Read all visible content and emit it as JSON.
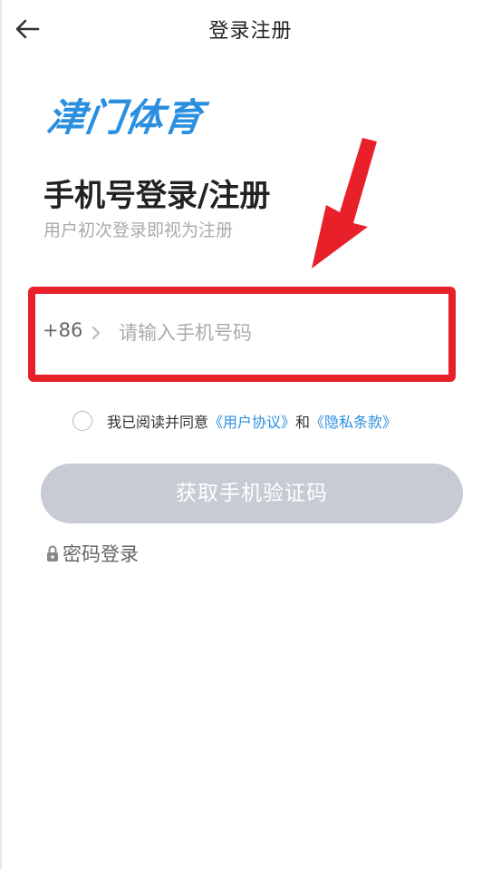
{
  "header": {
    "title": "登录注册",
    "back_icon": "back-arrow-icon"
  },
  "brand": {
    "name": "津门体育",
    "color": "#2b8fe0"
  },
  "login": {
    "heading": "手机号登录/注册",
    "subheading": "用户初次登录即视为注册"
  },
  "phone": {
    "country_code": "+86",
    "placeholder": "请输入手机号码",
    "value": ""
  },
  "agreement": {
    "checked": false,
    "prefix": "我已阅读并同意",
    "user_agreement": "《用户协议》",
    "and": "和",
    "privacy_policy": "《隐私条款》",
    "link_color": "#2b8fe0"
  },
  "actions": {
    "get_code": "获取手机验证码",
    "password_login": "密码登录",
    "button_color": "#c7cbd3"
  },
  "annotation": {
    "highlight_color": "#e8202a"
  }
}
